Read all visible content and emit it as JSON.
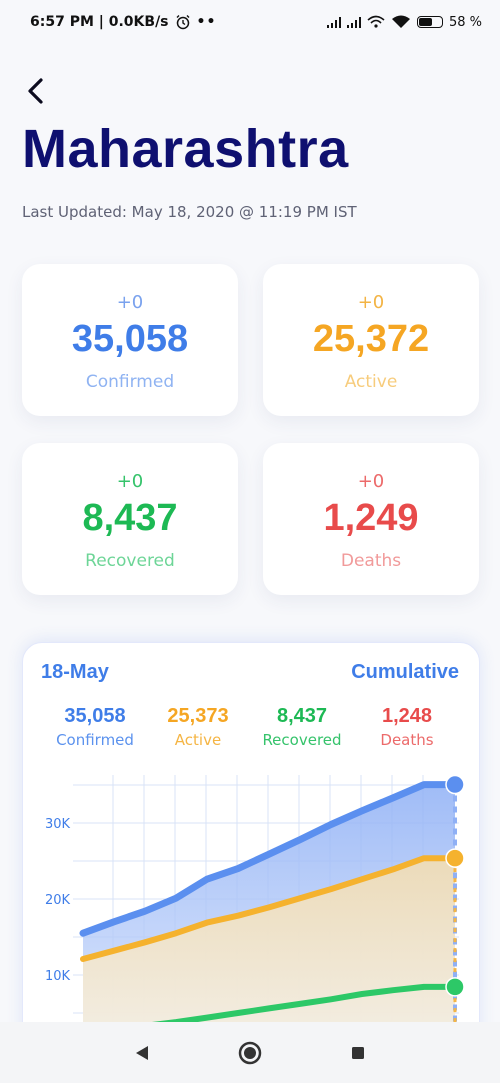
{
  "status_bar": {
    "time_speed": "6:57 PM | 0.0KB/s",
    "battery_percent": "58",
    "icons": [
      "alarm-icon",
      "more-dots-icon",
      "signal-icon",
      "signal-icon",
      "wifi-calling-icon",
      "wifi-icon",
      "battery-icon"
    ]
  },
  "header": {
    "back_icon": "chevron-left-icon",
    "title": "Maharashtra",
    "last_updated": "Last Updated: May 18, 2020 @ 11:19 PM IST"
  },
  "colors": {
    "confirmed": "#3f7de8",
    "active": "#f5a623",
    "recovered": "#1db954",
    "deaths": "#e84b4b",
    "title": "#0f1070"
  },
  "stats": [
    {
      "key": "confirmed",
      "delta": "+0",
      "value": "35,058",
      "label": "Confirmed"
    },
    {
      "key": "active",
      "delta": "+0",
      "value": "25,372",
      "label": "Active"
    },
    {
      "key": "recovered",
      "delta": "+0",
      "value": "8,437",
      "label": "Recovered"
    },
    {
      "key": "deaths",
      "delta": "+0",
      "value": "1,249",
      "label": "Deaths"
    }
  ],
  "chart_card": {
    "date": "18-May",
    "mode": "Cumulative",
    "summary": [
      {
        "key": "confirmed",
        "value": "35,058",
        "label": "Confirmed"
      },
      {
        "key": "active",
        "value": "25,373",
        "label": "Active"
      },
      {
        "key": "recovered",
        "value": "8,437",
        "label": "Recovered"
      },
      {
        "key": "deaths",
        "value": "1,248",
        "label": "Deaths"
      }
    ]
  },
  "chart_data": {
    "type": "area",
    "y_ticks": [
      "10K",
      "20K",
      "30K"
    ],
    "y_tick_values": [
      10000,
      20000,
      30000
    ],
    "ylim": [
      0,
      36000
    ],
    "grid": true,
    "x": [
      1,
      2,
      3,
      4,
      5,
      6,
      7,
      8,
      9,
      10,
      11,
      12,
      13
    ],
    "series": [
      {
        "name": "Confirmed",
        "values": [
          15500,
          17000,
          18400,
          20100,
          22600,
          24000,
          25900,
          27800,
          29800,
          31600,
          33300,
          35058,
          35058
        ]
      },
      {
        "name": "Active",
        "values": [
          12100,
          13200,
          14300,
          15500,
          16900,
          17800,
          18900,
          20100,
          21300,
          22600,
          23900,
          25373,
          25373
        ]
      },
      {
        "name": "Recovered",
        "values": [
          2500,
          2900,
          3300,
          3800,
          4400,
          5000,
          5600,
          6200,
          6800,
          7500,
          8000,
          8437,
          8437
        ]
      }
    ]
  },
  "nav": {
    "icons": [
      "back-triangle-icon",
      "home-circle-icon",
      "recents-square-icon"
    ]
  }
}
